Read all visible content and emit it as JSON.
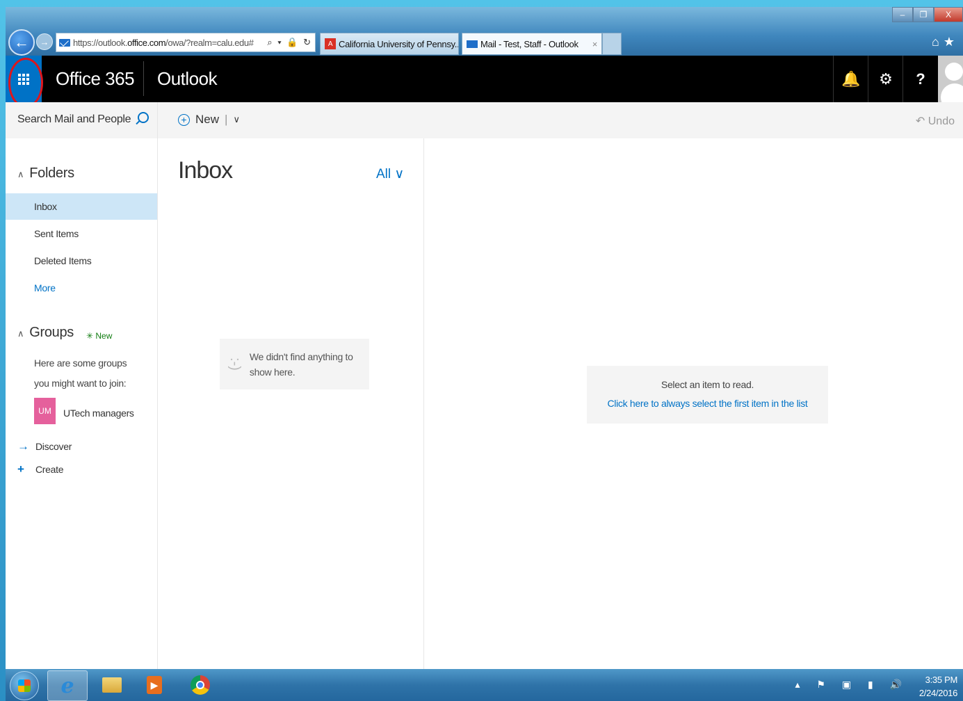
{
  "browser": {
    "url_prefix": "https://outlook.",
    "url_domain": "office.com",
    "url_suffix": "/owa/?realm=calu.edu#",
    "address_tools": "⌕ ▾ 🔒 ↻",
    "tabs": [
      {
        "title": "California University of Pennsy...",
        "icon": "pdf-icon"
      },
      {
        "title": "Mail - Test, Staff - Outlook",
        "icon": "mail-icon",
        "close": "×"
      }
    ],
    "window_controls": [
      "–",
      "❐",
      "X"
    ],
    "toolbar_icons": "⌂★"
  },
  "header": {
    "brand": "Office 365",
    "app": "Outlook",
    "icons": [
      "bell-icon",
      "gear-icon",
      "help-icon"
    ],
    "bell": "🔔",
    "gear": "⚙",
    "help": "?"
  },
  "search": {
    "placeholder": "Search Mail and People"
  },
  "commands": {
    "new_label": "New",
    "separator": "|",
    "chevron": "∨",
    "undo_label": "Undo"
  },
  "folders": {
    "title": "Folders",
    "items": [
      {
        "label": "Inbox",
        "selected": true
      },
      {
        "label": "Sent Items"
      },
      {
        "label": "Deleted Items"
      },
      {
        "label": "More"
      }
    ]
  },
  "groups": {
    "title": "Groups",
    "new_badge": "New",
    "hint_line1": "Here are some groups",
    "hint_line2": "you might want to join:",
    "group_initials": "UM",
    "group_name": "UTech managers",
    "discover": "Discover",
    "create": "Create"
  },
  "list": {
    "title": "Inbox",
    "filter": "All",
    "empty_face": ":-)",
    "empty_line1": "We didn't find anything to",
    "empty_line2": "show here."
  },
  "reading": {
    "line1": "Select an item to read.",
    "line2": "Click here to always select the first item in the list"
  },
  "taskbar": {
    "apps": [
      "start-button",
      "internet-explorer",
      "file-explorer",
      "media-player",
      "chrome"
    ],
    "ie_glyph": "e",
    "media_glyph": "▶",
    "tray_icons": "▴ ⚑ ▣ ▮ 🔊",
    "time": "3:35 PM",
    "date": "2/24/2016"
  },
  "colors": {
    "accent": "#0072c6",
    "header": "#000000",
    "highlight_ring": "#e0151b",
    "group_tile": "#e5609c"
  }
}
